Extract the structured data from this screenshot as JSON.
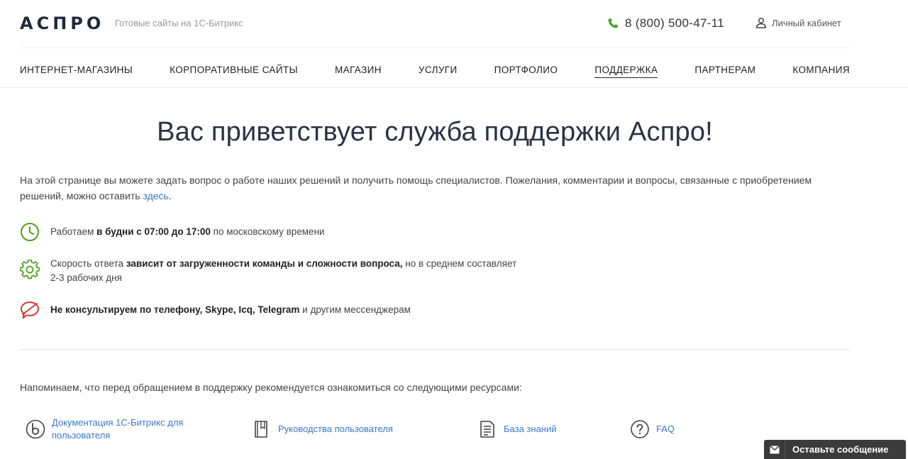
{
  "header": {
    "logo": "АСПРО",
    "tagline": "Готовые сайты на 1С-Битрикс",
    "phone": "8 (800) 500-47-11",
    "account": "Личный кабинет"
  },
  "nav": {
    "items": [
      {
        "label": "ИНТЕРНЕТ-МАГАЗИНЫ"
      },
      {
        "label": "КОРПОРАТИВНЫЕ САЙТЫ"
      },
      {
        "label": "МАГАЗИН"
      },
      {
        "label": "УСЛУГИ"
      },
      {
        "label": "ПОРТФОЛИО"
      },
      {
        "label": "ПОДДЕРЖКА",
        "active": true
      },
      {
        "label": "ПАРТНЕРАМ"
      },
      {
        "label": "КОМПАНИЯ"
      }
    ]
  },
  "main": {
    "title": "Вас приветствует служба поддержки Аспро!",
    "intro_text": "На этой странице вы можете задать вопрос о работе наших решений и получить помощь специалистов. Пожелания, комментарии и вопросы, связанные с приобретением решений, можно оставить ",
    "intro_link": "здесь",
    "intro_end": ".",
    "features": [
      {
        "icon": "clock-icon",
        "pre": "Работаем ",
        "bold": "в будни с 07:00 до 17:00",
        "post": " по московскому времени",
        "color": "#4aa11f"
      },
      {
        "icon": "gear-icon",
        "pre": "Скорость ответа ",
        "bold": "зависит от загруженности команды и сложности вопроса,",
        "post": " но в среднем составляет",
        "line2": "2-3 рабочих дня",
        "color": "#4aa11f"
      },
      {
        "icon": "no-chat-icon",
        "pre": "",
        "bold": "Не консультируем по телефону, Skype, Icq, Telegram",
        "post": " и другим мессенджерам",
        "color": "#d23b32"
      }
    ],
    "reminder": "Напоминаем, что перед обращением в поддержку рекомендуется ознакомиться со следующими ресурсами:",
    "resources": [
      {
        "icon": "bitrix-icon",
        "line1": "Документация 1С-Битрикс для",
        "line2": "пользователя"
      },
      {
        "icon": "book-icon",
        "line1": "Руководства пользователя"
      },
      {
        "icon": "document-icon",
        "line1": "База знаний"
      },
      {
        "icon": "question-icon",
        "line1": "FAQ"
      }
    ]
  },
  "chat_widget": {
    "label": "Оставьте сообщение",
    "icon": "envelope-icon"
  },
  "colors": {
    "accent_green": "#4aa11f",
    "accent_red": "#d23b32",
    "link_blue": "#3a78c3",
    "text_dark": "#222222"
  }
}
